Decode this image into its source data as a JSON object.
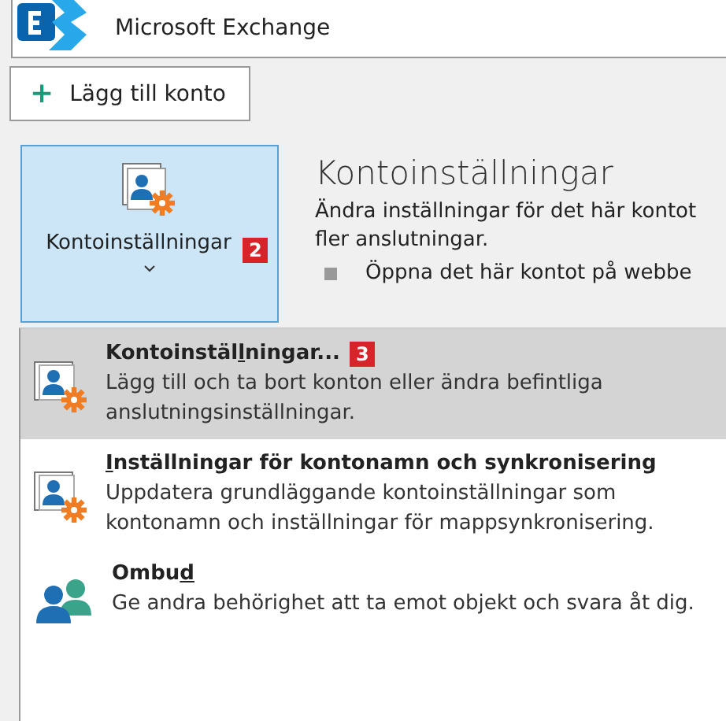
{
  "account": {
    "type": "Microsoft Exchange"
  },
  "add_account_button": {
    "label": "Lägg till konto",
    "icon": "+"
  },
  "account_settings_button": {
    "label": "Kontoinställningar",
    "badge": "2",
    "expanded": true
  },
  "info": {
    "title": "Kontoinställningar",
    "description_lines": [
      "Ändra inställningar för det här kontot",
      "fler anslutningar."
    ],
    "bullet": "Öppna det här kontot på webbe"
  },
  "menu_items": [
    {
      "kind": "settings",
      "title": {
        "before": "Kontoinstäl",
        "key": "l",
        "after": "ningar..."
      },
      "badge": "3",
      "description": "Lägg till och ta bort konton eller ändra befintliga anslutningsinställningar.",
      "selected": true
    },
    {
      "kind": "settings",
      "title": {
        "key": "I",
        "after": "nställningar för kontonamn och synkronisering"
      },
      "description": "Uppdatera grundläggande kontoinställningar som kontonamn och inställningar för mappsynkronisering.",
      "selected": false
    },
    {
      "kind": "delegate",
      "title": {
        "before": "Ombu",
        "key": "d"
      },
      "description": "Ge andra behörighet att ta emot objekt och svara åt dig.",
      "selected": false
    }
  ]
}
